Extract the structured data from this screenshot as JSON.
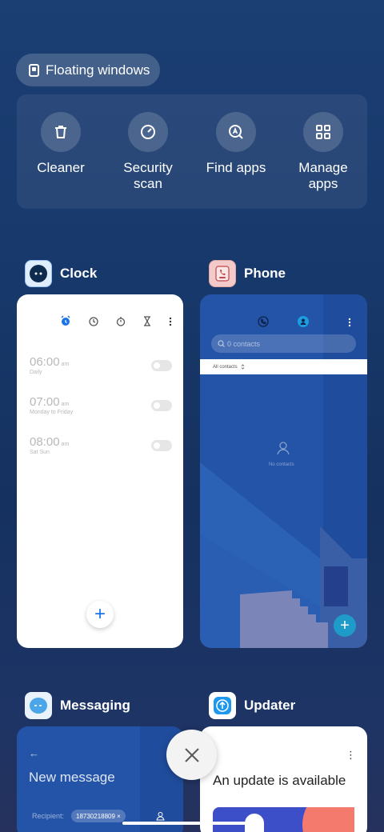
{
  "floating_windows": {
    "label": "Floating windows",
    "icon": "floating-window-icon"
  },
  "quick_actions": [
    {
      "label": "Cleaner",
      "icon": "trash-icon"
    },
    {
      "label": "Security\nscan",
      "icon": "security-scan-icon"
    },
    {
      "label": "Find apps",
      "icon": "find-apps-icon"
    },
    {
      "label": "Manage\napps",
      "icon": "grid-icon"
    }
  ],
  "apps": {
    "clock": {
      "name": "Clock",
      "alarms": [
        {
          "time": "06:00",
          "ampm": "am",
          "repeat": "Daily"
        },
        {
          "time": "07:00",
          "ampm": "am",
          "repeat": "Monday to Friday"
        },
        {
          "time": "08:00",
          "ampm": "am",
          "repeat": "Sat Sun"
        }
      ],
      "add": "+"
    },
    "phone": {
      "name": "Phone",
      "search_placeholder": "0 contacts",
      "filter": "All contacts",
      "empty": "No contacts",
      "add": "+"
    },
    "messaging": {
      "name": "Messaging",
      "back": "←",
      "title": "New message",
      "recipient_label": "Recipient:",
      "recipient_chip": "18730218809 ×"
    },
    "updater": {
      "name": "Updater",
      "title": "An update is available",
      "menu": "⋮"
    }
  },
  "colors": {
    "accent_blue": "#1a73e8",
    "phone_bg": "#2454a8",
    "fab_teal": "#1e9bc8"
  }
}
